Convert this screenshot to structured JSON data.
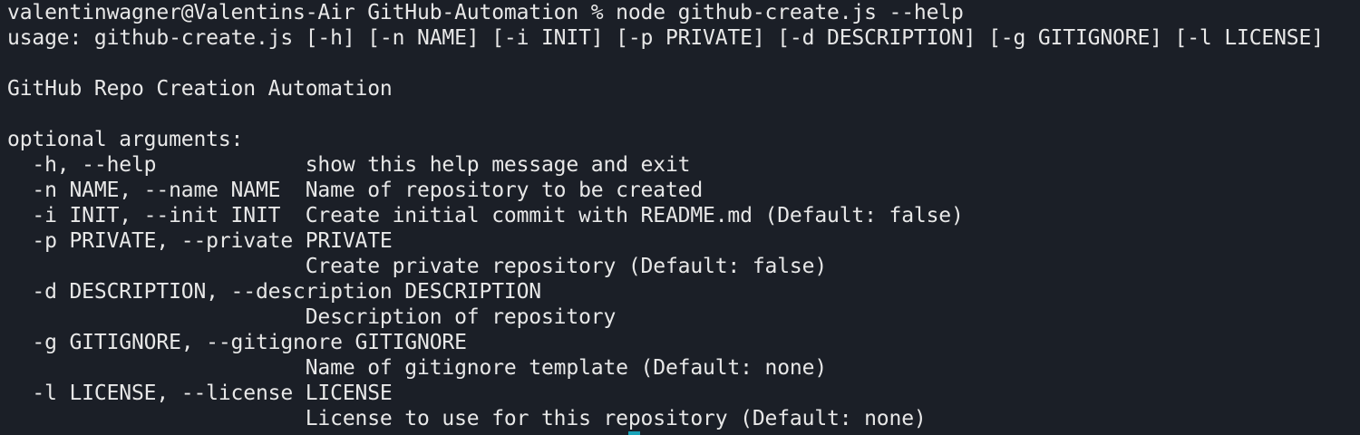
{
  "terminal": {
    "lines": [
      "valentinwagner@Valentins-Air GitHub-Automation % node github-create.js --help",
      "usage: github-create.js [-h] [-n NAME] [-i INIT] [-p PRIVATE] [-d DESCRIPTION] [-g GITIGNORE] [-l LICENSE]",
      "",
      "GitHub Repo Creation Automation",
      "",
      "optional arguments:",
      "  -h, --help            show this help message and exit",
      "  -n NAME, --name NAME  Name of repository to be created",
      "  -i INIT, --init INIT  Create initial commit with README.md (Default: false)",
      "  -p PRIVATE, --private PRIVATE",
      "                        Create private repository (Default: false)",
      "  -d DESCRIPTION, --description DESCRIPTION",
      "                        Description of repository",
      "  -g GITIGNORE, --gitignore GITIGNORE",
      "                        Name of gitignore template (Default: none)",
      "  -l LICENSE, --license LICENSE",
      "                        License to use for this repository (Default: none)"
    ]
  },
  "colors": {
    "background": "#1b1f27",
    "foreground": "#e8e8e8",
    "cursor": "#1aa3b8"
  }
}
